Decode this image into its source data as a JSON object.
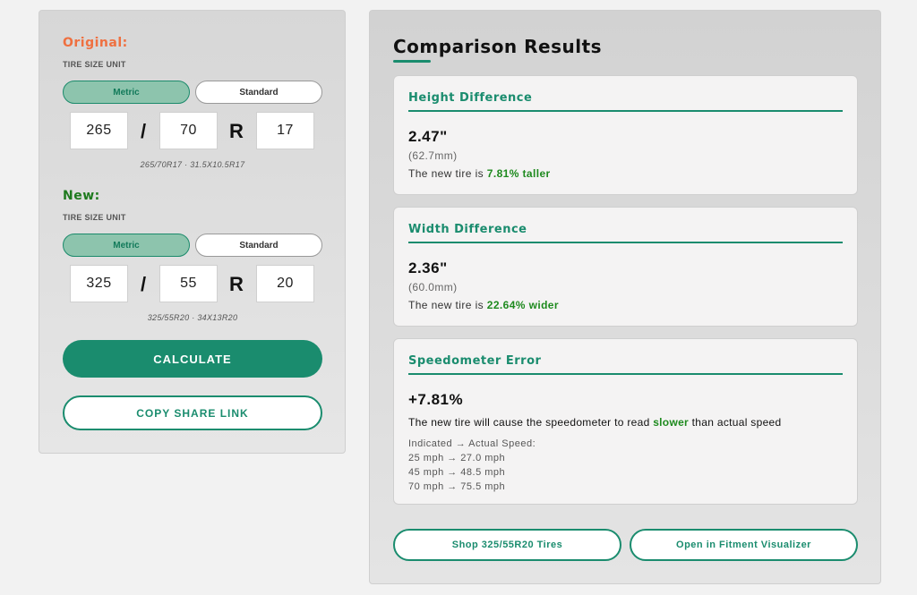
{
  "original": {
    "title": "Original:",
    "unit_label": "TIRE SIZE UNIT",
    "toggle_metric": "Metric",
    "toggle_standard": "Standard",
    "width": "265",
    "separator": "/",
    "aspect": "70",
    "construction": "R",
    "rim": "17",
    "caption": "265/70R17 · 31.5X10.5R17"
  },
  "new": {
    "title": "New:",
    "unit_label": "TIRE SIZE UNIT",
    "toggle_metric": "Metric",
    "toggle_standard": "Standard",
    "width": "325",
    "separator": "/",
    "aspect": "55",
    "construction": "R",
    "rim": "20",
    "caption": "325/55R20 · 34X13R20"
  },
  "actions": {
    "calculate": "CALCULATE",
    "copy_link": "COPY SHARE LINK"
  },
  "results": {
    "title": "Comparison Results",
    "height": {
      "title": "Height Difference",
      "value": "2.47\"",
      "mm": "(62.7mm)",
      "desc_prefix": "The new tire is ",
      "highlight": "7.81% taller"
    },
    "width": {
      "title": "Width Difference",
      "value": "2.36\"",
      "mm": "(60.0mm)",
      "desc_prefix": "The new tire is ",
      "highlight": "22.64% wider"
    },
    "speedometer": {
      "title": "Speedometer Error",
      "value": "+7.81%",
      "desc_prefix": "The new tire will cause the speedometer to read ",
      "highlight": "slower",
      "desc_suffix": " than actual speed",
      "list_header": "Indicated → Actual Speed:",
      "rows": [
        "25 mph → 27.0 mph",
        "45 mph → 48.5 mph",
        "70 mph → 75.5 mph"
      ]
    },
    "shop_button": "Shop 325/55R20 Tires",
    "visualizer_button": "Open in Fitment Visualizer"
  },
  "colors": {
    "accent": "#1a8c6e",
    "original_title": "#ef7040",
    "new_title": "#1e7a1e",
    "highlight": "#1e8a1e"
  }
}
